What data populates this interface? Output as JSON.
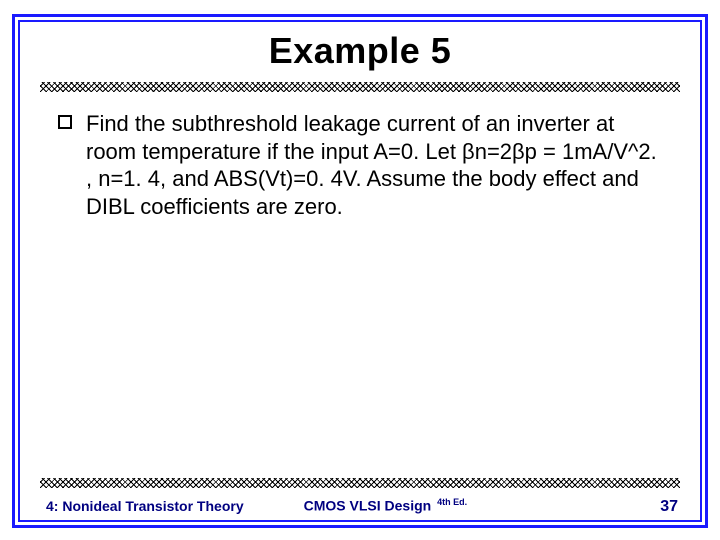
{
  "title": "Example 5",
  "bullet": {
    "text": "Find the subthreshold leakage current of an inverter at room temperature if the input A=0. Let βn=2βp = 1mA/V^2. , n=1. 4, and ABS(Vt)=0. 4V. Assume the body effect and DIBL coefficients are zero."
  },
  "footer": {
    "left": "4: Nonideal Transistor Theory",
    "center_main": "CMOS VLSI Design",
    "center_ed": "4th Ed.",
    "page": "37"
  }
}
